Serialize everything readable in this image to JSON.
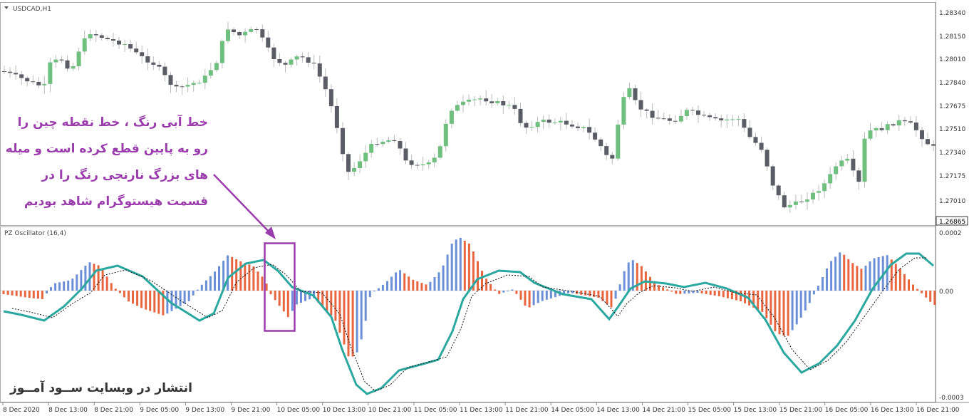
{
  "main_panel": {
    "symbol_label": "USDCAD,H1",
    "price_axis_labels": [
      "1.28340",
      "1.28150",
      "1.28010",
      "1.27840",
      "1.27675",
      "1.27510",
      "1.27340",
      "1.27175",
      "1.27010"
    ],
    "current_price": "1.26865"
  },
  "oscillator_panel": {
    "label": "PZ Oscillator (16,4)",
    "axis_labels": [
      "0.0002",
      "0.00",
      "-0.0003"
    ]
  },
  "time_axis_labels": [
    "8 Dec 2020",
    "8 Dec 13:00",
    "8 Dec 21:00",
    "9 Dec 05:00",
    "9 Dec 13:00",
    "9 Dec 21:00",
    "10 Dec 05:00",
    "10 Dec 13:00",
    "10 Dec 21:00",
    "11 Dec 05:00",
    "11 Dec 13:00",
    "11 Dec 21:00",
    "14 Dec 05:00",
    "14 Dec 13:00",
    "14 Dec 21:00",
    "15 Dec 05:00",
    "15 Dec 13:00",
    "15 Dec 21:00",
    "16 Dec 05:00",
    "16 Dec 13:00",
    "16 Dec 21:00"
  ],
  "annotation": {
    "lines": [
      "خط آبی رنگ ، خط نقطه چین را",
      "رو به پایین قطع کرده است و میله",
      "های بزرگ نارنجی رنگ را در",
      "قسمت هیستوگرام شاهد بودیم"
    ]
  },
  "watermark": "انتشار در وبسایت ســود آمــوز",
  "colors": {
    "bull_candle": "#6fbf7f",
    "bear_candle": "#5b5d66",
    "hist_positive": "#6a8fd6",
    "hist_negative": "#e8663f",
    "signal_line": "#2aa8a0",
    "annotation": "#9b3cad"
  }
}
